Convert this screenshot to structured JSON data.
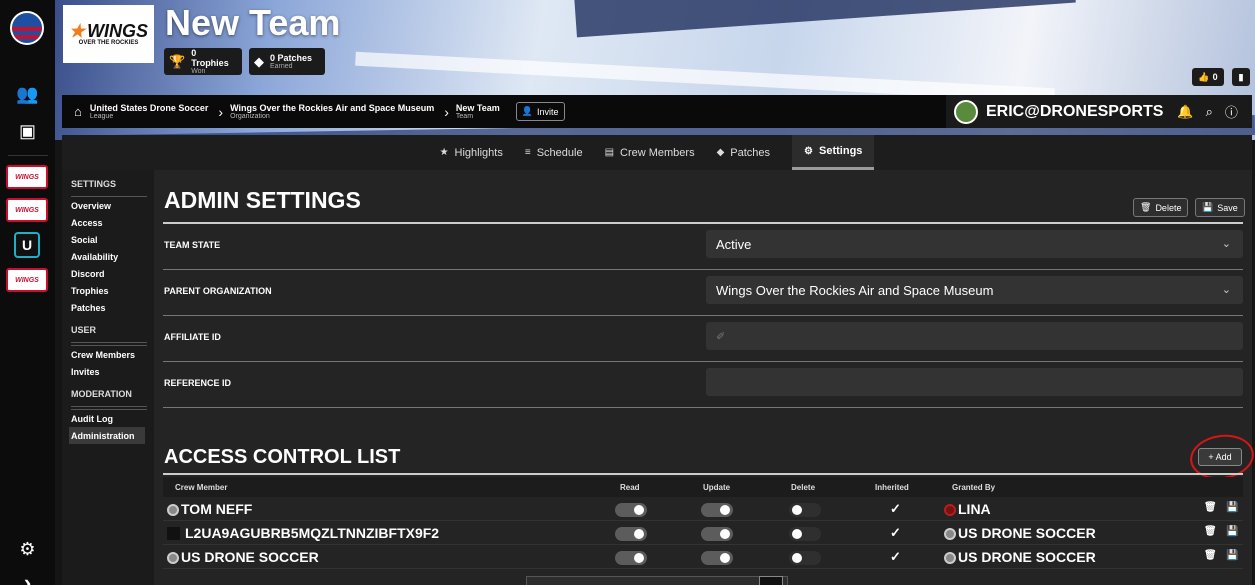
{
  "rail": {
    "team_logo_text": "WINGS",
    "u_label": "U"
  },
  "hero": {
    "team_logo_big": "WINGS",
    "team_logo_small": "OVER THE ROCKIES",
    "title": "New Team",
    "trophies_label": "0 Trophies",
    "trophies_sub": "Won",
    "patches_label": "0 Patches",
    "patches_sub": "Earned",
    "like_count": "0"
  },
  "breadcrumb": [
    {
      "name": "United States Drone Soccer",
      "type": "League"
    },
    {
      "name": "Wings Over the Rockies Air and Space Museum",
      "type": "Organization"
    },
    {
      "name": "New Team",
      "type": "Team"
    }
  ],
  "invite_label": "Invite",
  "user": {
    "name": "ERIC@DRONESPORTS"
  },
  "tabs": [
    {
      "label": "Highlights",
      "icon": "star-icon"
    },
    {
      "label": "Schedule",
      "icon": "list-icon"
    },
    {
      "label": "Crew Members",
      "icon": "crew-icon"
    },
    {
      "label": "Patches",
      "icon": "shield-icon"
    },
    {
      "label": "Settings",
      "icon": "gear-icon",
      "active": true
    }
  ],
  "sidebar": {
    "settings_header": "SETTINGS",
    "settings_items": [
      "Overview",
      "Access",
      "Social",
      "Availability",
      "Discord",
      "Trophies",
      "Patches"
    ],
    "user_header": "USER",
    "user_items": [
      "Crew Members",
      "Invites"
    ],
    "moderation_header": "MODERATION",
    "moderation_items": [
      "Audit Log",
      "Administration"
    ]
  },
  "admin": {
    "title": "ADMIN SETTINGS",
    "delete_label": "Delete",
    "save_label": "Save",
    "fields": {
      "team_state_label": "TEAM STATE",
      "team_state_value": "Active",
      "parent_org_label": "PARENT ORGANIZATION",
      "parent_org_value": "Wings Over the Rockies Air and Space Museum",
      "affiliate_label": "AFFILIATE ID",
      "reference_label": "REFERENCE ID"
    }
  },
  "acl": {
    "title": "ACCESS CONTROL LIST",
    "add_label": "+ Add",
    "columns": {
      "crew": "Crew Member",
      "read": "Read",
      "update": "Update",
      "delete": "Delete",
      "inherited": "Inherited",
      "granted": "Granted By"
    },
    "rows": [
      {
        "member": "TOM NEFF",
        "read": true,
        "update": true,
        "delete": false,
        "inherited": "✓",
        "granted_by": "LINA"
      },
      {
        "member": "L2UA9AGUBRB5MQZLTNNZIBFTX9F2",
        "read": true,
        "update": true,
        "delete": false,
        "inherited": "✓",
        "granted_by": "US DRONE SOCCER"
      },
      {
        "member": "US DRONE SOCCER",
        "read": true,
        "update": true,
        "delete": false,
        "inherited": "✓",
        "granted_by": "US DRONE SOCCER"
      }
    ]
  },
  "colors": {
    "accent_red": "#c8102e",
    "wings_orange": "#f07d1d",
    "panel_bg": "#242424"
  }
}
